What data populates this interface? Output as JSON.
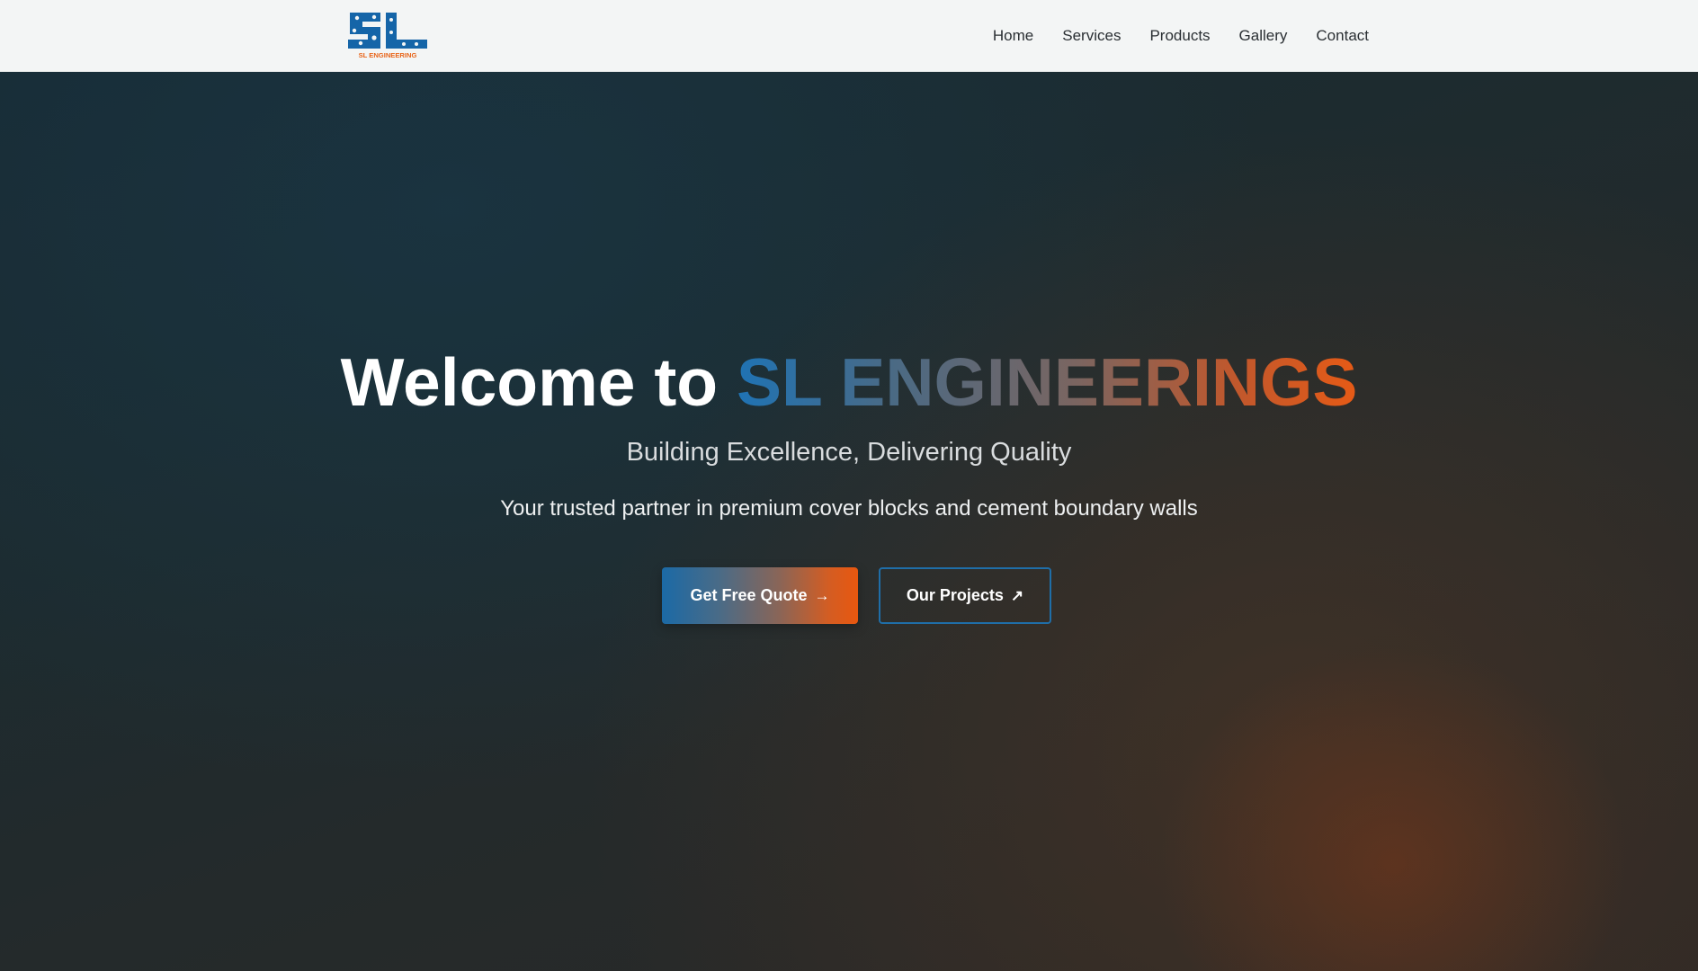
{
  "header": {
    "logo": {
      "monogram": "SL",
      "wordmark": "SL ENGINEERING",
      "colors": {
        "blue": "#1565a8",
        "orange": "#e8651a"
      }
    },
    "nav": [
      {
        "label": "Home"
      },
      {
        "label": "Services"
      },
      {
        "label": "Products"
      },
      {
        "label": "Gallery"
      },
      {
        "label": "Contact"
      }
    ]
  },
  "hero": {
    "title_prefix": "Welcome to",
    "title_brand": "SL ENGINEERINGS",
    "subtitle": "Building Excellence, Delivering Quality",
    "description": "Your trusted partner in premium cover blocks and cement boundary walls",
    "primary_cta": {
      "label": "Get Free Quote",
      "icon": "arrow-right-icon",
      "glyph": "→"
    },
    "secondary_cta": {
      "label": "Our Projects",
      "icon": "external-arrow-icon",
      "glyph": "↗"
    }
  },
  "colors": {
    "brand_blue": "#1f73b4",
    "brand_orange": "#e65a16",
    "nav_background": "#f3f5f5",
    "hero_background": "#1d2b2f"
  }
}
